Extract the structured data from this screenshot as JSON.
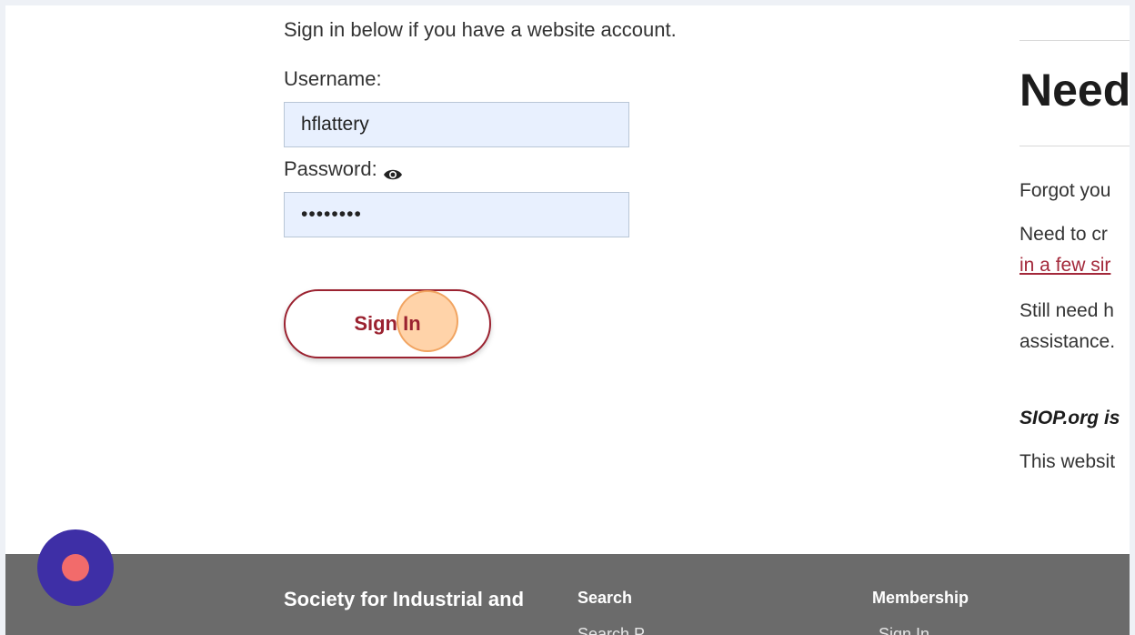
{
  "login": {
    "intro": "Sign in below if you have a website account.",
    "username_label": "Username:",
    "username_value": "hflattery",
    "password_label": "Password:",
    "password_value": "••••••••",
    "signin_label": "Sign In"
  },
  "sidebar": {
    "heading": "Need",
    "lines": [
      "Forgot you",
      "Need to cr",
      "in a few sir",
      "Still need h",
      "assistance.",
      "SIOP.org is",
      "This websit"
    ]
  },
  "footer": {
    "org_name": "Society for Industrial and",
    "col_search": "Search",
    "col_search_link": "Search P",
    "col_membership": "Membership",
    "col_membership_link": "Sign In"
  },
  "icons": {
    "eye": "eye-icon",
    "recorder": "record-icon"
  },
  "colors": {
    "accent": "#9b2230",
    "field_bg": "#e8f0fe",
    "footer_bg": "#6b6b6b",
    "recorder_bg": "#3e2fa6",
    "recorder_dot": "#f26b6b"
  }
}
